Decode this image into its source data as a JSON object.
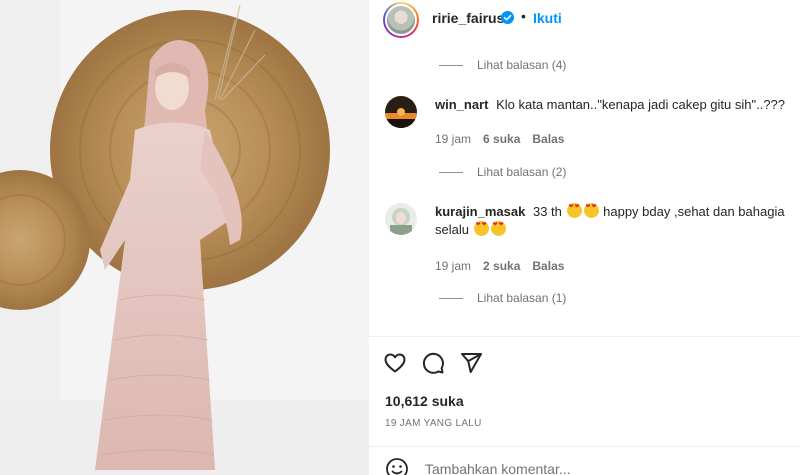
{
  "post": {
    "author": "ririe_fairus",
    "follow_label": "Ikuti",
    "separator": "•"
  },
  "comments": [
    {
      "view_replies": "Lihat balasan (4)"
    },
    {
      "username": "win_nart",
      "text": "Klo kata mantan..\"kenapa jadi cakep gitu sih\"..???",
      "time": "19 jam",
      "likes": "6 suka",
      "reply_label": "Balas",
      "view_replies": "Lihat balasan (2)"
    },
    {
      "username": "kurajin_masak",
      "text_part1": "33 th",
      "text_part2": "happy bday ,sehat dan bahagia",
      "text_part3": "selalu",
      "time": "19 jam",
      "likes": "2 suka",
      "reply_label": "Balas",
      "view_replies": "Lihat balasan (1)"
    }
  ],
  "actions": {
    "like_icon": "heart-icon",
    "comment_icon": "comment-icon",
    "share_icon": "share-icon"
  },
  "likes_count": "10,612 suka",
  "time_ago": "19 JAM YANG LALU",
  "add_comment": {
    "placeholder": "Tambahkan komentar..."
  },
  "colors": {
    "accent": "#0095f6",
    "text": "#262626",
    "muted": "#737373",
    "divider": "#efefef"
  }
}
